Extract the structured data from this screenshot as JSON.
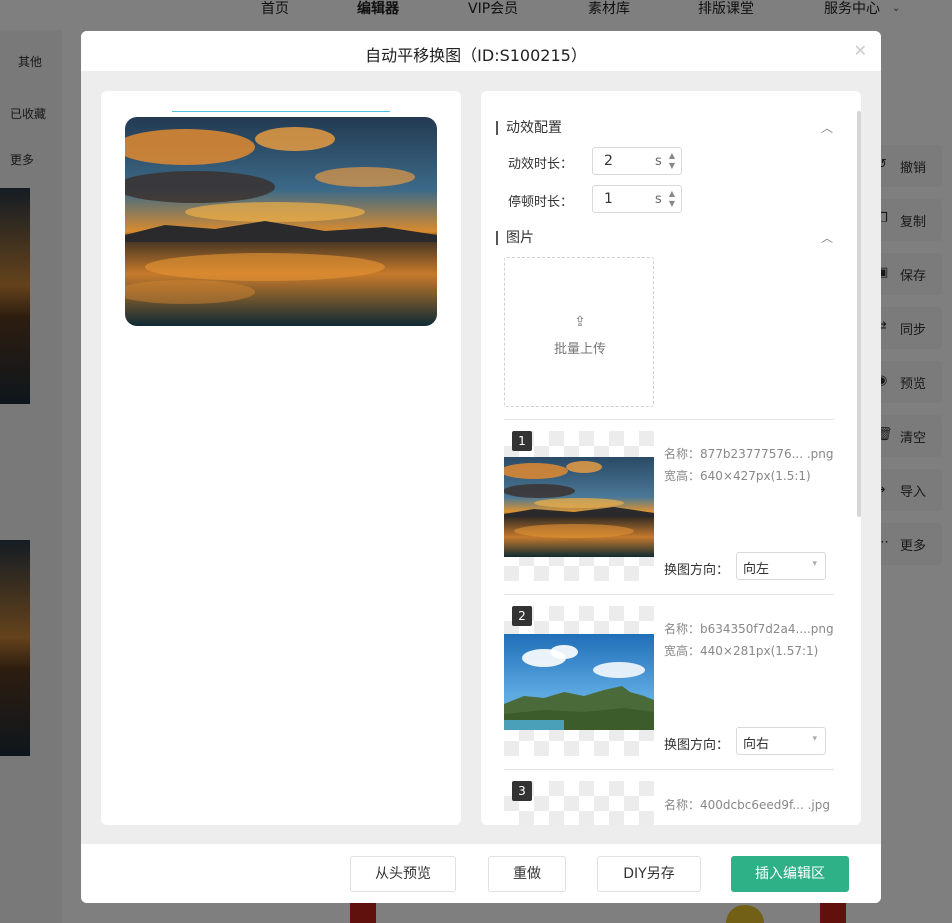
{
  "topnav": {
    "items": [
      "首页",
      "编辑器",
      "VIP会员",
      "素材库",
      "排版课堂",
      "服务中心"
    ]
  },
  "leftside": {
    "tabs": [
      "其他",
      "已收藏",
      "更多"
    ]
  },
  "rightside": {
    "buttons": [
      {
        "label": "撤销",
        "icon": "undo-icon"
      },
      {
        "label": "复制",
        "icon": "copy-icon"
      },
      {
        "label": "保存",
        "icon": "save-icon"
      },
      {
        "label": "同步",
        "icon": "sync-icon"
      },
      {
        "label": "预览",
        "icon": "eye-icon"
      },
      {
        "label": "清空",
        "icon": "trash-icon"
      },
      {
        "label": "导入",
        "icon": "import-icon"
      },
      {
        "label": "更多",
        "icon": "more-icon"
      }
    ]
  },
  "modal": {
    "title": "自动平移换图（ID:S100215）",
    "close_icon": "close-icon"
  },
  "config": {
    "section_title": "动效配置",
    "duration_label": "动效时长：",
    "duration_value": "2",
    "duration_unit": "s",
    "pause_label": "停顿时长：",
    "pause_value": "1",
    "pause_unit": "s"
  },
  "images": {
    "section_title": "图片",
    "upload_label": "批量上传",
    "items": [
      {
        "index": "1",
        "name": "名称：877b23777576... .png",
        "size": "宽高：640×427px(1.5:1)",
        "dir_label": "换图方向：",
        "dir_value": "向左"
      },
      {
        "index": "2",
        "name": "名称：b634350f7d2a4....png",
        "size": "宽高：440×281px(1.57:1)",
        "dir_label": "换图方向：",
        "dir_value": "向右"
      },
      {
        "index": "3",
        "name": "名称：400dcbc6eed9f... .jpg"
      }
    ]
  },
  "footer": {
    "replay": "从头预览",
    "redo": "重做",
    "save_diy": "DIY另存",
    "insert": "插入编辑区"
  },
  "colors": {
    "primary": "#2fb188",
    "preview_line": "#4fc3e0"
  }
}
